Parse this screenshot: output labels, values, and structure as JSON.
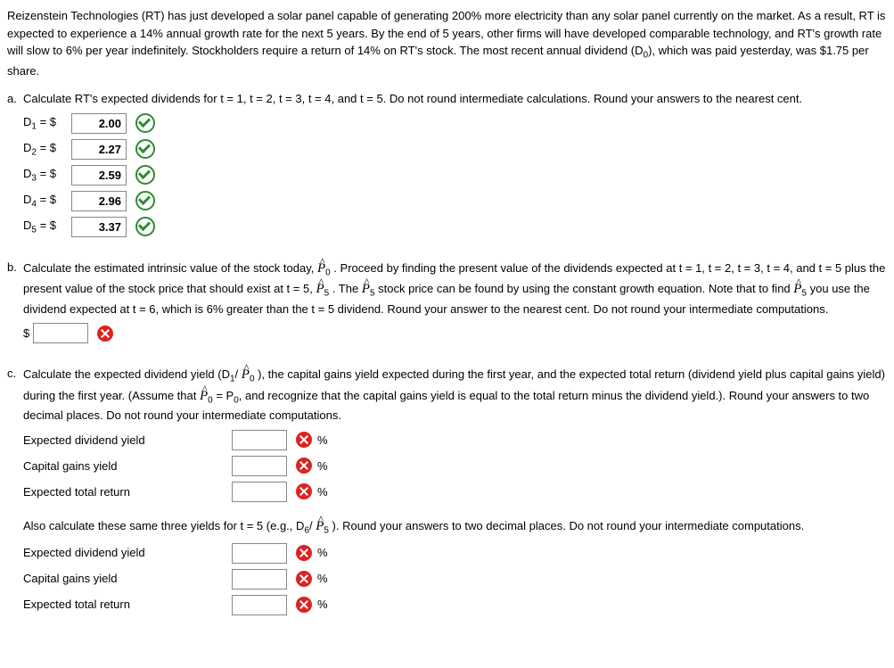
{
  "intro": "Reizenstein Technologies (RT) has just developed a solar panel capable of generating 200% more electricity than any solar panel currently on the market. As a result, RT is expected to experience a 14% annual growth rate for the next 5 years. By the end of 5 years, other firms will have developed comparable technology, and RT's growth rate will slow to 6% per year indefinitely. Stockholders require a return of 14% on RT's stock. The most recent annual dividend (D",
  "intro2": "), which was paid yesterday, was $1.75 per share.",
  "a": {
    "letter": "a.",
    "prompt": "Calculate RT's expected dividends for t = 1, t = 2, t = 3, t = 4, and t = 5. Do not round intermediate calculations. Round your answers to the nearest cent.",
    "rows": [
      {
        "label_pre": "D",
        "sub": "1",
        "label_post": " = $",
        "value": "2.00"
      },
      {
        "label_pre": "D",
        "sub": "2",
        "label_post": " = $",
        "value": "2.27"
      },
      {
        "label_pre": "D",
        "sub": "3",
        "label_post": " = $",
        "value": "2.59"
      },
      {
        "label_pre": "D",
        "sub": "4",
        "label_post": " = $",
        "value": "2.96"
      },
      {
        "label_pre": "D",
        "sub": "5",
        "label_post": " = $",
        "value": "3.37"
      }
    ]
  },
  "b": {
    "letter": "b.",
    "t1": "Calculate the estimated intrinsic value of the stock today, ",
    "phat0": "P",
    "sub0": "0",
    "t2": " . Proceed by finding the present value of the dividends expected at t = 1, t = 2, t = 3, t = 4, and t = 5 plus the present value of the stock price that should exist at t = 5, ",
    "phat5a": "P",
    "sub5a": "5",
    "t3": " . The ",
    "phat5b": "P",
    "sub5b": "5",
    "t4": " stock price can be found by using the constant growth equation. Note that to find ",
    "phat5c": "P",
    "sub5c": "5",
    "t5": " you use the dividend expected at t = 6, which is 6% greater than the t = 5 dividend. Round your answer to the nearest cent. Do not round your intermediate computations.",
    "dollar": "$"
  },
  "c": {
    "letter": "c.",
    "t1": "Calculate the expected dividend yield (D",
    "sub1": "1",
    "t2": "/ ",
    "phat0": "P",
    "psub0": "0",
    "t3": " ), the capital gains yield expected during the first year, and the expected total return (dividend yield plus capital gains yield) during the first year. (Assume that ",
    "phat0b": "P",
    "psub0b": "0",
    "t4": " = P",
    "sub0b": "0",
    "t5": ", and recognize that the capital gains yield is equal to the total return minus the dividend yield.). Round your answers to two decimal places. Do not round your intermediate computations.",
    "labels": {
      "edy": "Expected dividend yield",
      "cgy": "Capital gains yield",
      "etr": "Expected total return"
    },
    "pct": "%",
    "also_t1": "Also calculate these same three yields for t = 5 (e.g., D",
    "also_sub6": "6",
    "also_t2": "/ ",
    "also_phat5": "P",
    "also_psub5": "5",
    "also_t3": " ). Round your answers to two decimal places. Do not round your intermediate computations."
  }
}
